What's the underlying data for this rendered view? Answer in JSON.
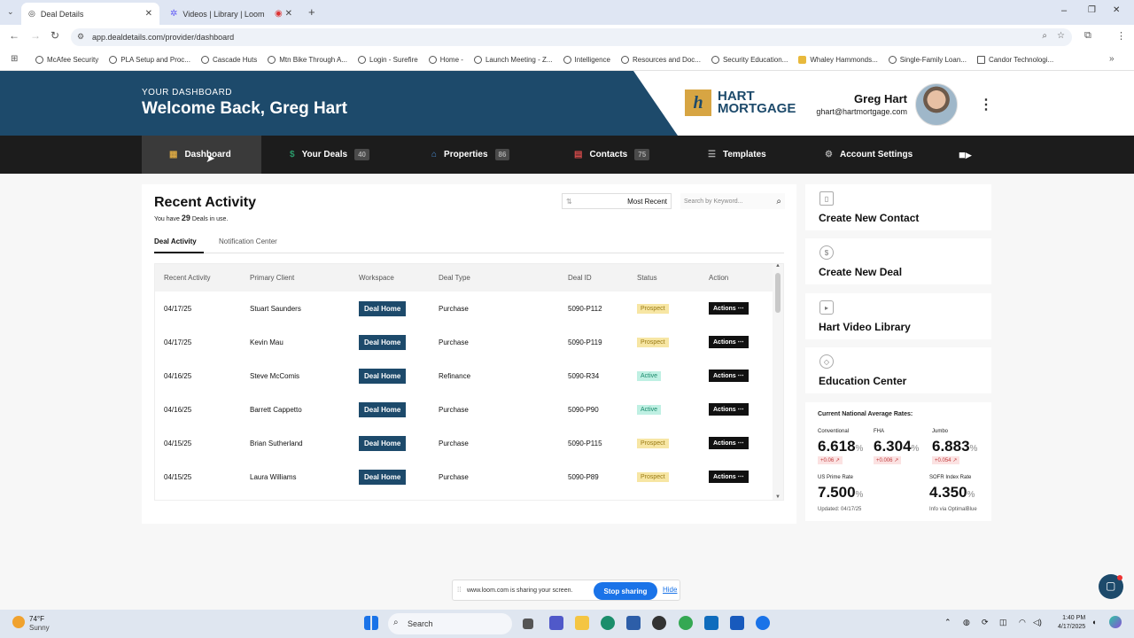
{
  "browser": {
    "tabs": [
      {
        "label": "Deal Details",
        "active": true
      },
      {
        "label": "Videos | Library | Loom",
        "active": false
      },
      {
        "label": "",
        "active": false
      }
    ],
    "url": "app.dealdetails.com/provider/dashboard",
    "bookmarks": [
      "McAfee Security",
      "PLA Setup and Proc...",
      "Cascade Huts",
      "Mtn Bike Through A...",
      "Login - Surefire",
      "Home -",
      "Launch Meeting - Z...",
      "Intelligence",
      "Resources and Doc...",
      "Security Education...",
      "Whaley Hammonds...",
      "Single-Family Loan...",
      "Candor Technologi..."
    ]
  },
  "header": {
    "eyebrow": "YOUR DASHBOARD",
    "welcome": "Welcome Back, Greg Hart",
    "logo_mark": "h",
    "logo_line1": "HART",
    "logo_line2": "MORTGAGE",
    "user_name": "Greg Hart",
    "user_email": "ghart@hartmortgage.com"
  },
  "nav": {
    "dashboard": "Dashboard",
    "your_deals": "Your Deals",
    "your_deals_count": "40",
    "properties": "Properties",
    "properties_count": "86",
    "contacts": "Contacts",
    "contacts_count": "75",
    "templates": "Templates",
    "account_settings": "Account Settings"
  },
  "main": {
    "title": "Recent Activity",
    "sub_prefix": "You have",
    "sub_count": "29",
    "sub_suffix": "Deals in use.",
    "sort_label": "Most Recent",
    "search_placeholder": "Search by Keyword...",
    "tab_deal_activity": "Deal Activity",
    "tab_notification": "Notification Center",
    "columns": [
      "Recent Activity",
      "Primary Client",
      "Workspace",
      "Deal Type",
      "Deal ID",
      "Status",
      "Action"
    ],
    "workspace_label": "Deal Home",
    "action_label": "Actions",
    "rows": [
      {
        "date": "04/17/25",
        "client": "Stuart Saunders",
        "type": "Purchase",
        "id": "5090-P112",
        "status": "Prospect"
      },
      {
        "date": "04/17/25",
        "client": "Kevin Mau",
        "type": "Purchase",
        "id": "5090-P119",
        "status": "Prospect"
      },
      {
        "date": "04/16/25",
        "client": "Steve McComis",
        "type": "Refinance",
        "id": "5090-R34",
        "status": "Active"
      },
      {
        "date": "04/16/25",
        "client": "Barrett Cappetto",
        "type": "Purchase",
        "id": "5090-P90",
        "status": "Active"
      },
      {
        "date": "04/15/25",
        "client": "Brian Sutherland",
        "type": "Purchase",
        "id": "5090-P115",
        "status": "Prospect"
      },
      {
        "date": "04/15/25",
        "client": "Laura Williams",
        "type": "Purchase",
        "id": "5090-P89",
        "status": "Prospect"
      }
    ]
  },
  "sidebar": {
    "create_contact": "Create New Contact",
    "create_deal": "Create New Deal",
    "video_library": "Hart Video Library",
    "education": "Education Center"
  },
  "rates": {
    "title": "Current National Average Rates:",
    "conventional_label": "Conventional",
    "conventional_value": "6.618",
    "conventional_change": "+0.06",
    "fha_label": "FHA",
    "fha_value": "6.304",
    "fha_change": "+0.006",
    "jumbo_label": "Jumbo",
    "jumbo_value": "6.883",
    "jumbo_change": "+0.054",
    "prime_label": "US Prime Rate",
    "prime_value": "7.500",
    "sofr_label": "SOFR Index Rate",
    "sofr_value": "4.350",
    "updated": "Updated: 04/17/25",
    "source": "Info via OptimalBlue",
    "percent": "%"
  },
  "share": {
    "text": "www.loom.com is sharing your screen.",
    "stop": "Stop sharing",
    "hide": "Hide"
  },
  "taskbar": {
    "temp": "74°F",
    "condition": "Sunny",
    "search": "Search",
    "time": "1:40 PM",
    "date": "4/17/2025"
  },
  "colors": {
    "brand_blue": "#1d4a6b",
    "gold": "#d7a543",
    "nav_bg": "#1c1c1c",
    "prospect": "#f7e6a4",
    "active": "#bff0e3"
  }
}
